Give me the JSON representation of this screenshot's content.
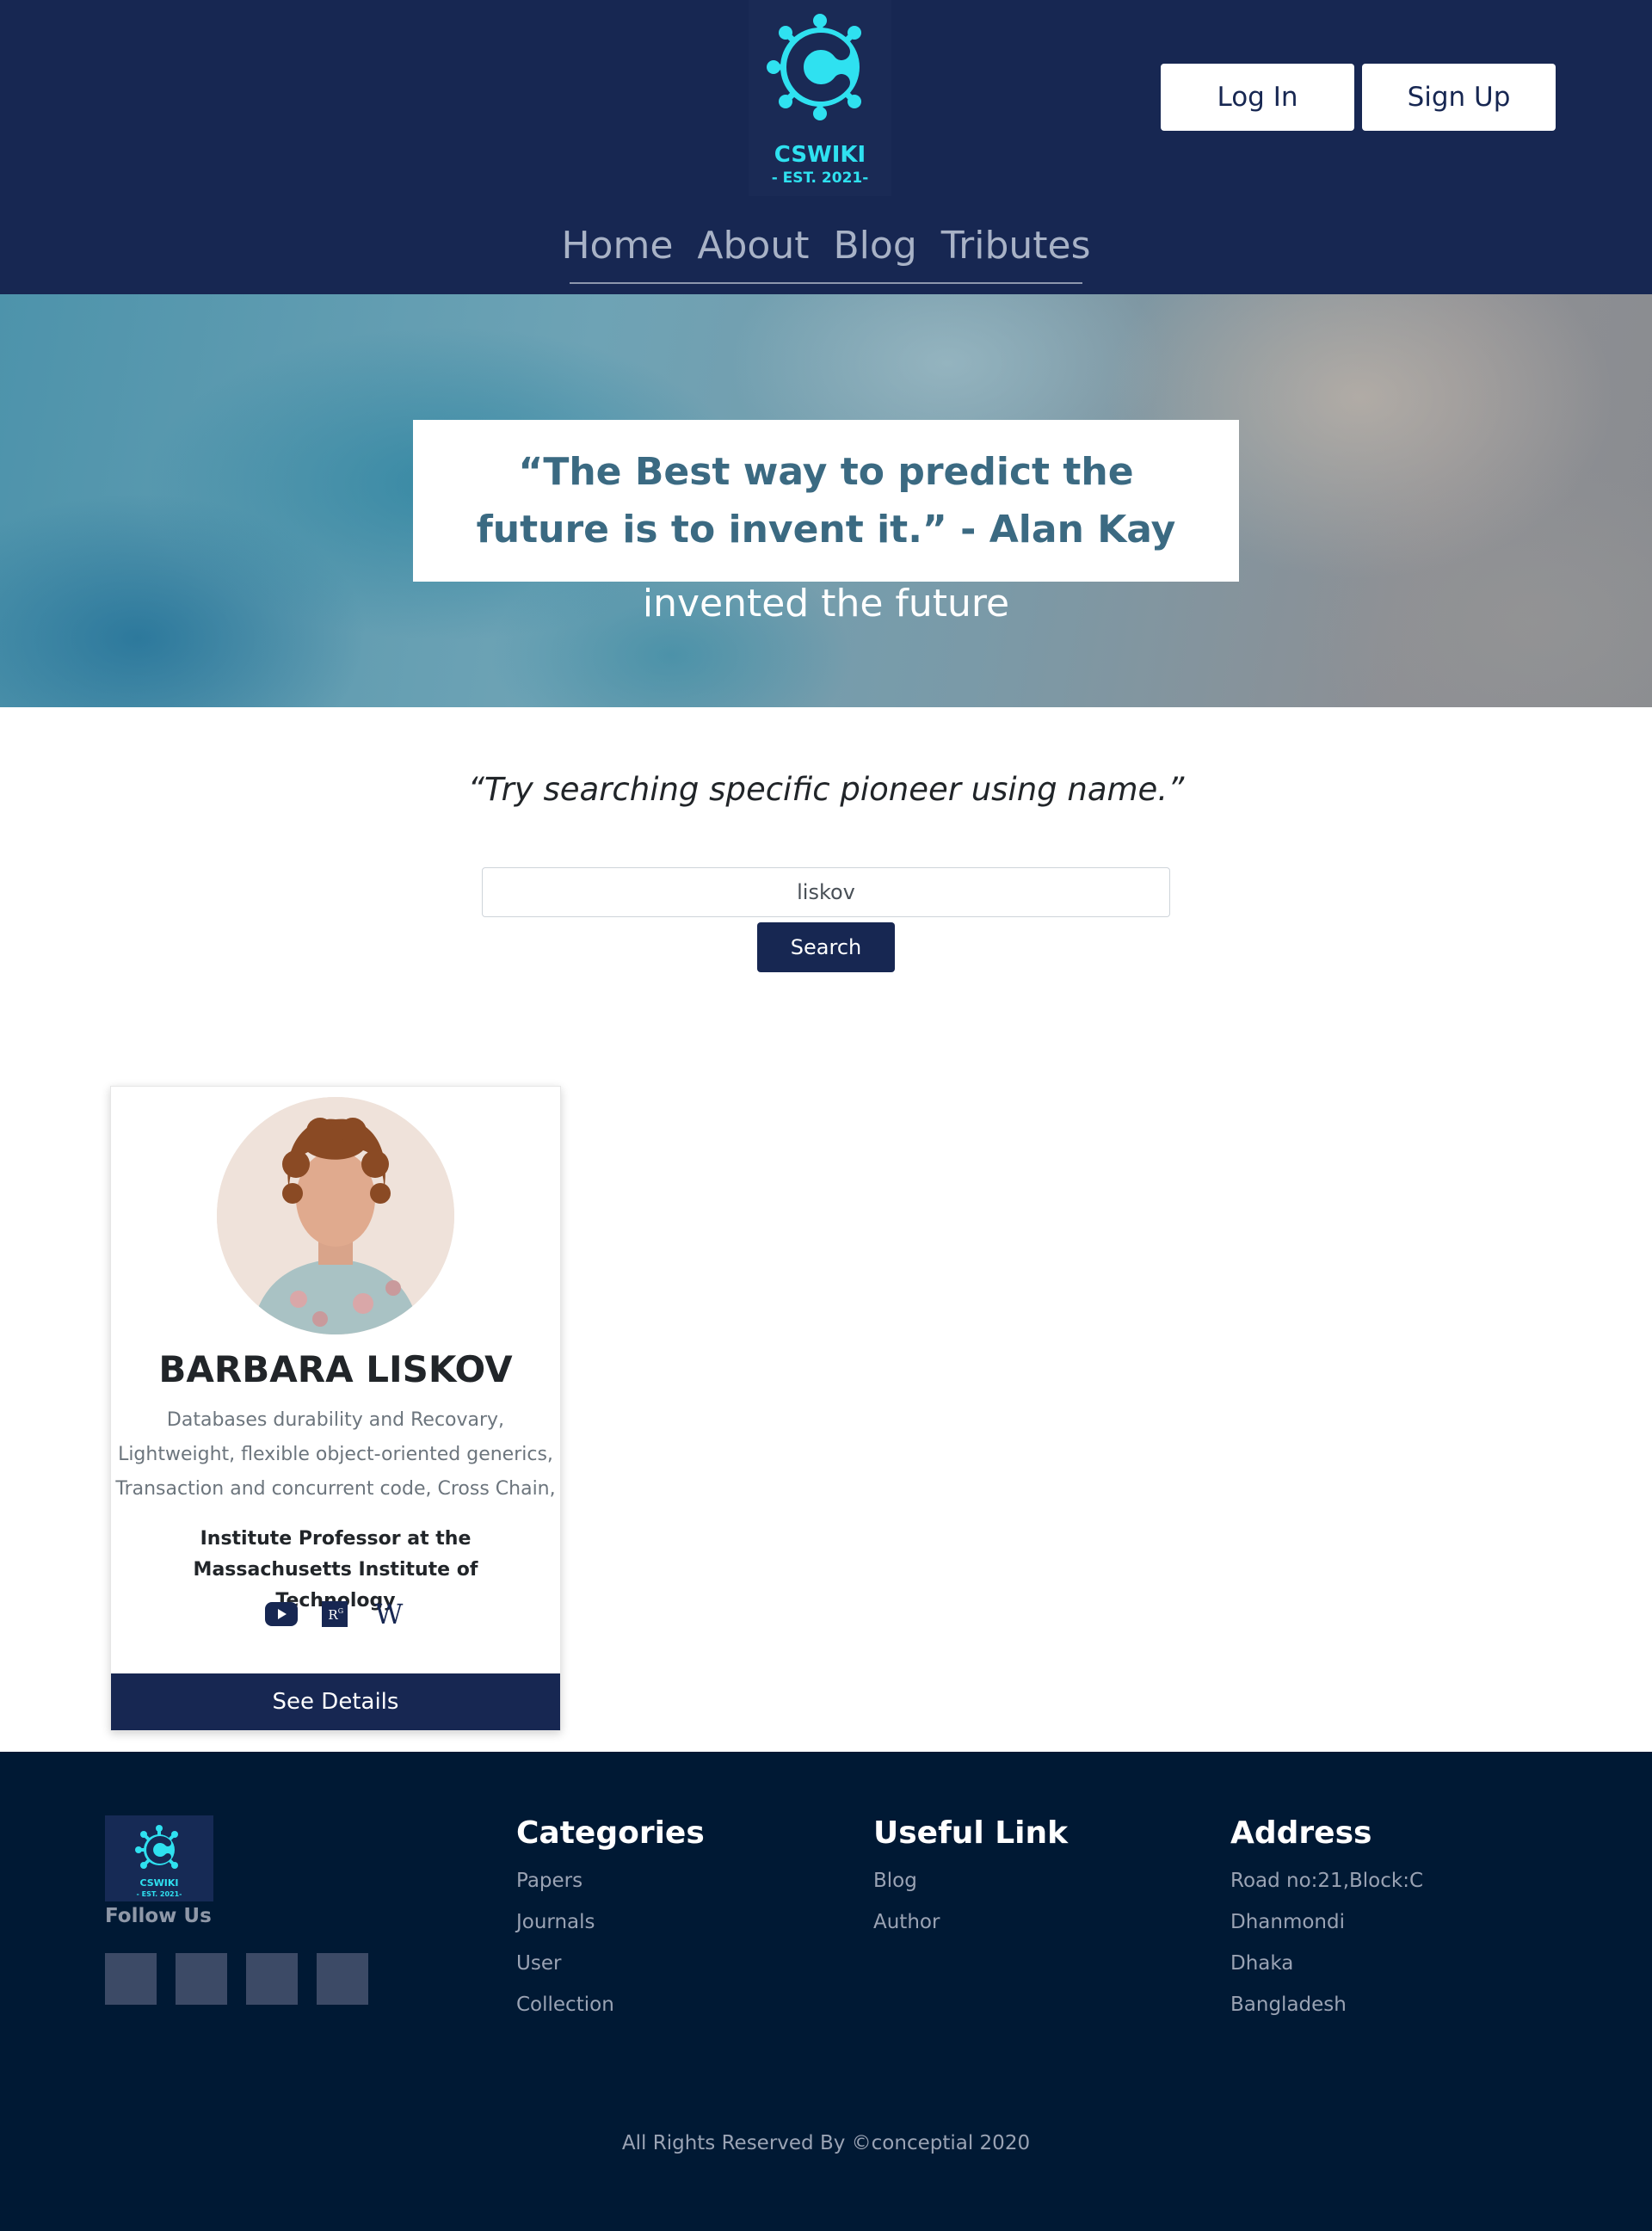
{
  "header": {
    "logo": {
      "name": "CSWIKI",
      "tagline": "- EST. 2021-",
      "icon": "virus-c-logo-icon"
    },
    "auth": {
      "login_label": "Log In",
      "signup_label": "Sign Up"
    },
    "nav": [
      {
        "label": "Home"
      },
      {
        "label": "About"
      },
      {
        "label": "Blog"
      },
      {
        "label": "Tributes"
      }
    ]
  },
  "hero": {
    "quote": "“The Best way to predict the future is to invent it.” - Alan Kay",
    "subtitle": "invented the future"
  },
  "search": {
    "hint": "“Try searching specific pioneer using name.”",
    "value": "liskov",
    "button_label": "Search"
  },
  "card": {
    "name": "BARBARA LISKOV",
    "topics": "Databases durability and Recovary, Lightweight, flexible object-oriented generics, Transaction and concurrent code, Cross Chain,",
    "role": "Institute Professor at the Massachusetts Institute of Technology",
    "links": [
      {
        "icon": "youtube-icon"
      },
      {
        "icon": "researchgate-icon",
        "text": "R"
      },
      {
        "icon": "wikipedia-icon",
        "text": "W"
      }
    ],
    "details_label": "See Details"
  },
  "footer": {
    "logo": {
      "name": "CSWIKI",
      "tagline": "- EST. 2021-"
    },
    "follow_label": "Follow Us",
    "categories": {
      "title": "Categories",
      "items": [
        "Papers",
        "Journals",
        "User",
        "Collection"
      ]
    },
    "useful": {
      "title": "Useful Link",
      "items": [
        "Blog",
        "Author"
      ]
    },
    "address": {
      "title": "Address",
      "items": [
        "Road no:21,Block:C",
        "Dhanmondi",
        "Dhaka",
        "Bangladesh"
      ]
    },
    "copyright": "All Rights Reserved By ©conceptial 2020"
  },
  "colors": {
    "primary": "#172752",
    "accent": "#2ad4e8",
    "footer_bg": "#001934",
    "quote_text": "#3b6a82"
  }
}
